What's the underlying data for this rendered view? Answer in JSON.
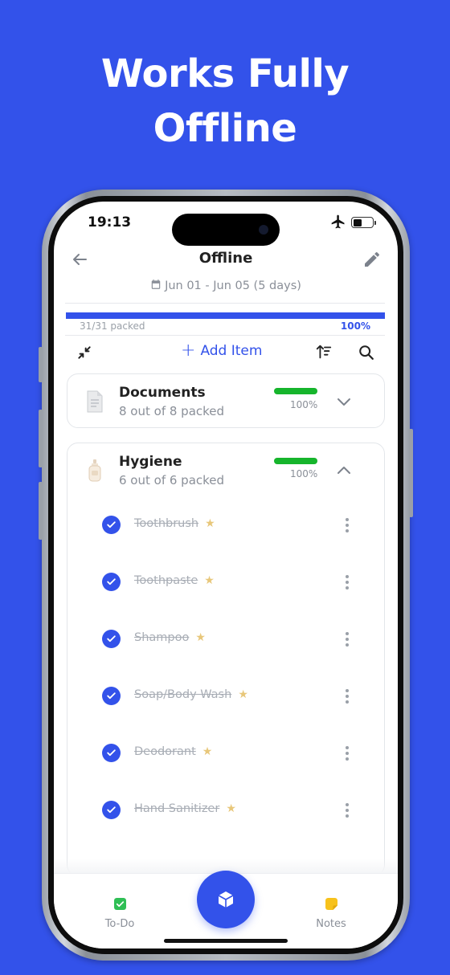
{
  "headline": [
    "Works Fully",
    "Offline"
  ],
  "status": {
    "time": "19:13",
    "battery_level": 0.45
  },
  "header": {
    "title": "Offline",
    "dates": "Jun 01 - Jun 05 (5 days)"
  },
  "progress": {
    "fraction": 1.0,
    "packed_text": "31/31 packed",
    "percent_text": "100%"
  },
  "toolbar": {
    "add_item_label": "Add Item"
  },
  "categories": [
    {
      "name": "Documents",
      "subtitle": "8 out of 8 packed",
      "percent": "100%",
      "fraction": 1.0,
      "expanded": false
    },
    {
      "name": "Hygiene",
      "subtitle": "6 out of 6 packed",
      "percent": "100%",
      "fraction": 1.0,
      "expanded": true
    }
  ],
  "items": [
    {
      "label": "Toothbrush",
      "checked": true,
      "starred": true
    },
    {
      "label": "Toothpaste",
      "checked": true,
      "starred": true
    },
    {
      "label": "Shampoo",
      "checked": true,
      "starred": true
    },
    {
      "label": "Soap/Body Wash",
      "checked": true,
      "starred": true
    },
    {
      "label": "Deodorant",
      "checked": true,
      "starred": true
    },
    {
      "label": "Hand Sanitizer",
      "checked": true,
      "starred": true
    }
  ],
  "bottom_nav": {
    "todo_label": "To-Do",
    "notes_label": "Notes"
  },
  "colors": {
    "background": "#3352ea",
    "accent": "#3352ea",
    "success": "#16b52c",
    "star": "#e8c77a",
    "todo_icon": "#2fbf55",
    "notes_icon": "#f7c21c"
  }
}
